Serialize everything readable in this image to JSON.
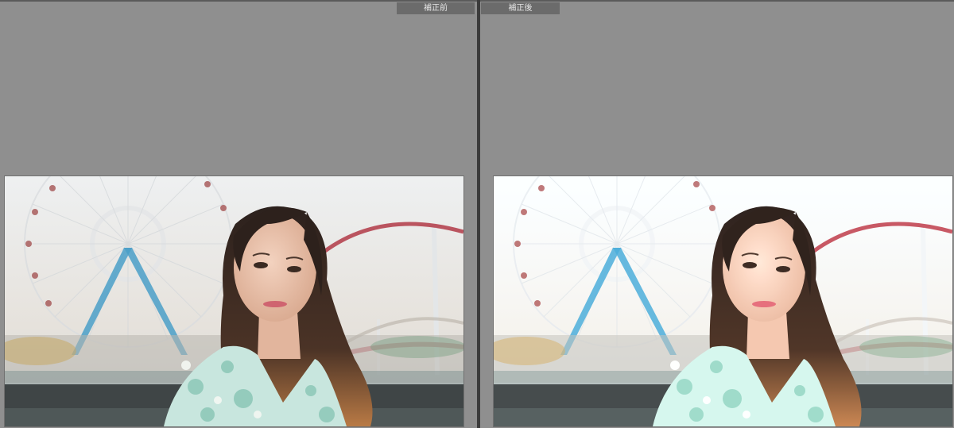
{
  "panes": {
    "before": {
      "label": "補正前"
    },
    "after": {
      "label": "補正後"
    }
  },
  "image": {
    "subject": "portrait",
    "sky_color": "#dfe3e6",
    "ferris_wheel_color": "#4a9fc8",
    "coaster_color": "#b23a47",
    "hair_color": "#3a2a22",
    "dress_color": "#c8e6de"
  }
}
